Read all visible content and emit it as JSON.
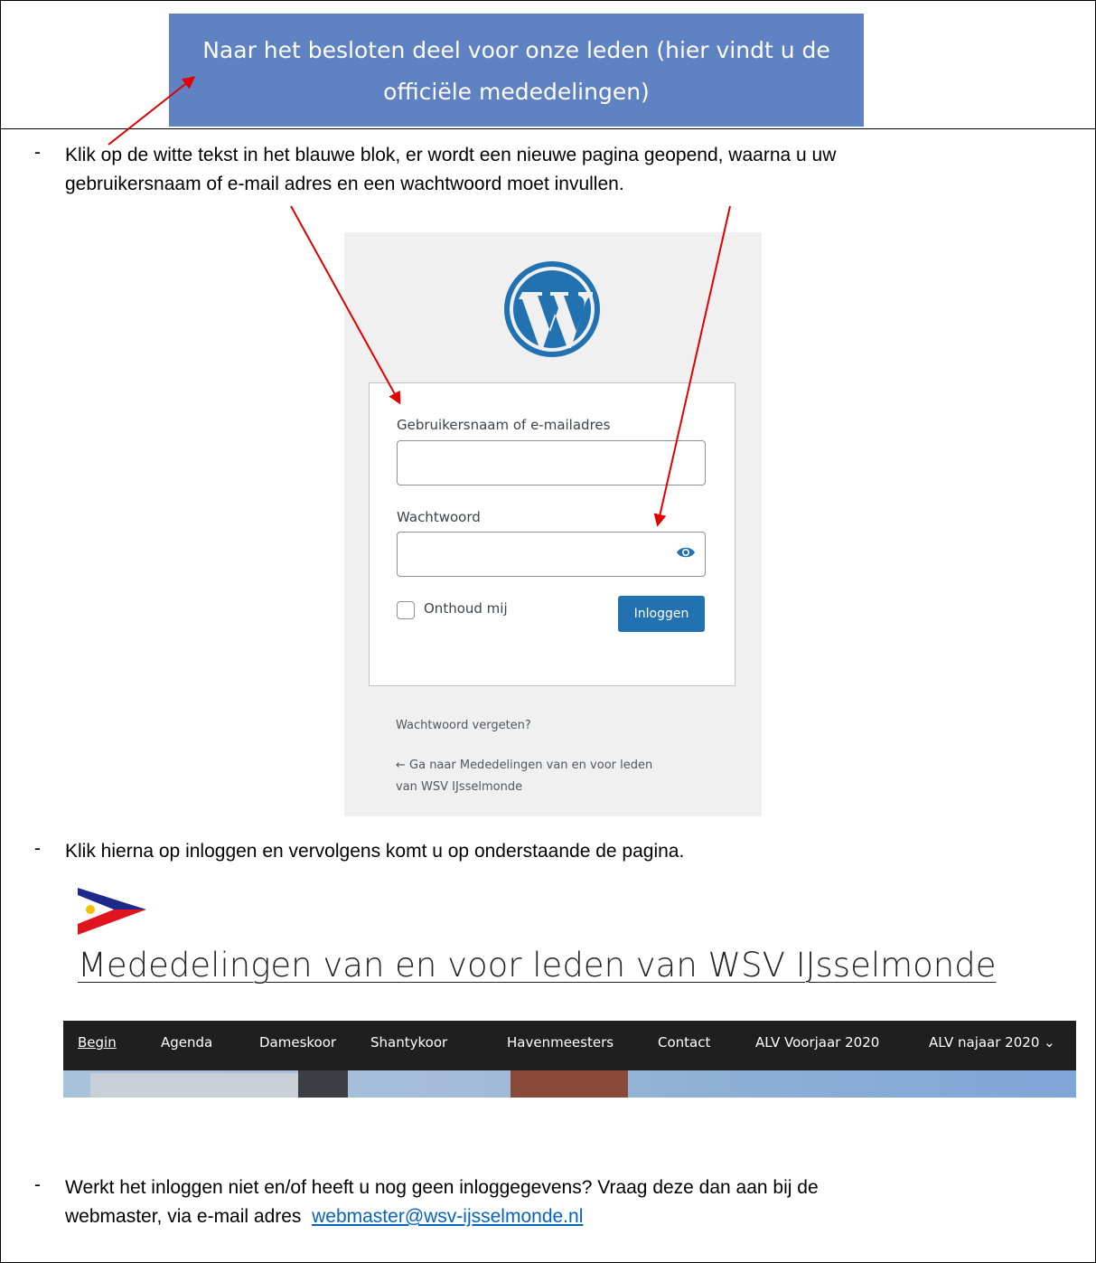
{
  "blue_block": {
    "line1": "Naar het besloten deel voor onze leden (hier vindt u de",
    "line2": "officiële mededelingen)",
    "color": "#5e82c2"
  },
  "step1": {
    "dash": "-",
    "line1": "Klik op de witte tekst in het blauwe blok, er wordt een nieuwe pagina geopend, waarna u uw",
    "line2": "gebruikersnaam of e-mail adres en een wachtwoord moet invullen."
  },
  "login": {
    "logo_icon": "wordpress-logo",
    "username_label": "Gebruikersnaam of e-mailadres",
    "username_value": "",
    "password_label": "Wachtwoord",
    "password_value": "",
    "show_password_icon": "eye-icon",
    "remember_label": "Onthoud mij",
    "remember_checked": false,
    "login_button": "Inloggen",
    "forgot_link": "Wachtwoord vergeten?",
    "back_link_line1": "← Ga naar Mededelingen van en voor leden",
    "back_link_line2": "van WSV IJsselmonde",
    "button_color": "#2271b1"
  },
  "step2": {
    "dash": "-",
    "text": "Klik hierna op inloggen en vervolgens komt u op onderstaande de pagina."
  },
  "site": {
    "logo_icon": "wsv-burgee-flag",
    "title": "Mededelingen van en voor leden van WSV IJsselmonde",
    "nav": [
      "Begin",
      "Agenda",
      "Dameskoor",
      "Shantykoor",
      "Havenmeesters",
      "Contact",
      "ALV Voorjaar 2020",
      "ALV najaar 2020"
    ],
    "nav_dropdown_icon": "chevron-down-icon",
    "nav_background": "#1f1f1f"
  },
  "step3": {
    "dash": "-",
    "line1": "Werkt het inloggen niet en/of heeft u nog geen inloggegevens? Vraag deze dan aan bij de",
    "line2_prefix": "webmaster, via e-mail adres",
    "email": "webmaster@wsv-ijsselmonde.nl"
  },
  "annotation_arrow_color": "#e00000"
}
